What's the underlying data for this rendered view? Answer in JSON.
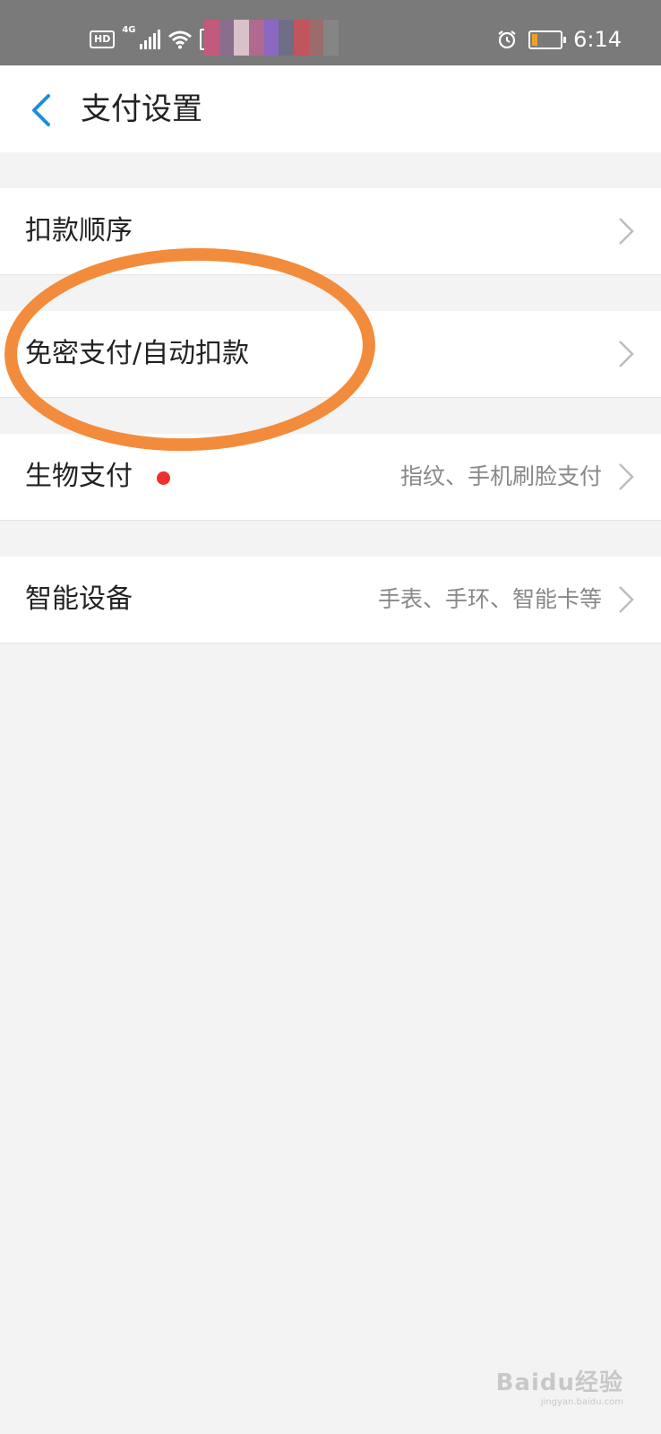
{
  "status_bar": {
    "left_badge": "HD",
    "network": "4G",
    "time": "6:14",
    "icons": [
      "hd-icon",
      "signal-icon",
      "wifi-icon",
      "battery-alert-icon",
      "alarm-icon",
      "battery-icon"
    ]
  },
  "header": {
    "title": "支付设置",
    "back_icon": "chevron-left-icon",
    "accent": "#1e8fd8"
  },
  "settings": {
    "items": [
      {
        "label": "扣款顺序",
        "value": ""
      },
      {
        "label": "免密支付/自动扣款",
        "value": ""
      },
      {
        "label": "生物支付",
        "value": "指纹、手机刷脸支付",
        "badge": "red-dot"
      },
      {
        "label": "智能设备",
        "value": "手表、手环、智能卡等"
      }
    ]
  },
  "annotation": {
    "shape": "ellipse",
    "color": "#f28c3c",
    "highlights": "免密支付/自动扣款"
  },
  "watermark": {
    "text": "Baidu经验",
    "url": "jingyan.baidu.com"
  }
}
